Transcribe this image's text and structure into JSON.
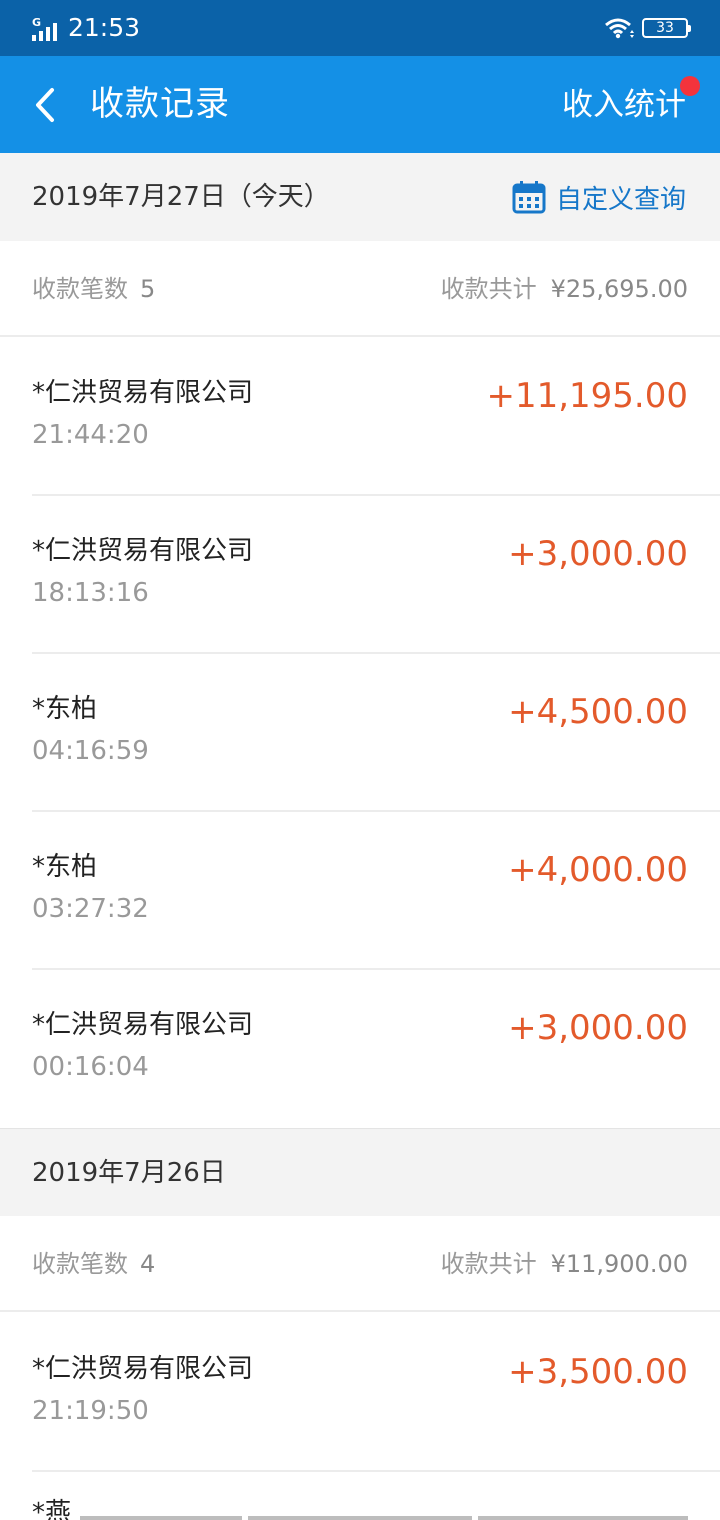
{
  "status_bar": {
    "time": "21:53",
    "signal_label": "G",
    "battery": "33"
  },
  "nav": {
    "title": "收款记录",
    "action": "收入统计"
  },
  "days": [
    {
      "date": "2019年7月27日（今天）",
      "custom_query": "自定义查询",
      "count_label": "收款笔数",
      "count": "5",
      "total_label": "收款共计",
      "total": "¥25,695.00",
      "records": [
        {
          "name": "*仁洪贸易有限公司",
          "time": "21:44:20",
          "amount": "+11,195.00"
        },
        {
          "name": "*仁洪贸易有限公司",
          "time": "18:13:16",
          "amount": "+3,000.00"
        },
        {
          "name": "*东柏",
          "time": "04:16:59",
          "amount": "+4,500.00"
        },
        {
          "name": "*东柏",
          "time": "03:27:32",
          "amount": "+4,000.00"
        },
        {
          "name": "*仁洪贸易有限公司",
          "time": "00:16:04",
          "amount": "+3,000.00"
        }
      ]
    },
    {
      "date": "2019年7月26日",
      "count_label": "收款笔数",
      "count": "4",
      "total_label": "收款共计",
      "total": "¥11,900.00",
      "records": [
        {
          "name": "*仁洪贸易有限公司",
          "time": "21:19:50",
          "amount": "+3,500.00"
        },
        {
          "name": "*燕",
          "time": "",
          "amount": ""
        }
      ]
    }
  ],
  "colors": {
    "status_bar": "#0b62a8",
    "nav_bar": "#1490e6",
    "amount": "#e35a2b",
    "link": "#1677c9",
    "badge": "#f4333c"
  },
  "icons": {
    "back": "chevron-left-icon",
    "calendar": "calendar-icon",
    "wifi": "wifi-icon",
    "battery": "battery-icon",
    "signal": "signal-icon"
  }
}
